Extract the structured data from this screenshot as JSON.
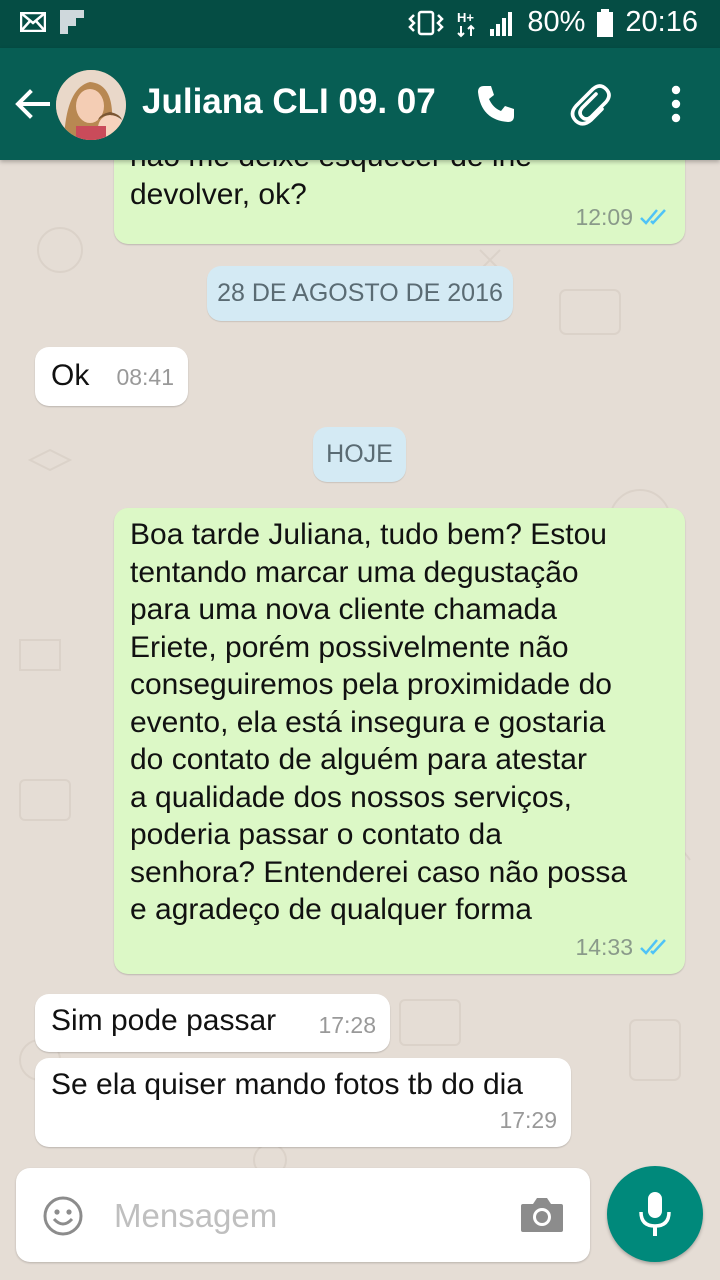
{
  "status_bar": {
    "battery": "80%",
    "time": "20:16",
    "icons": [
      "mail-icon",
      "flipboard-icon",
      "vibrate-icon",
      "hplus-icon",
      "signal-icon",
      "battery-icon"
    ]
  },
  "header": {
    "contact_name": "Juliana CLI 09. 07",
    "icons": [
      "back-arrow-icon",
      "phone-icon",
      "paperclip-icon",
      "more-vert-icon"
    ]
  },
  "messages": [
    {
      "direction": "outgoing",
      "text": "não me deixe esquecer de lhe\ndevolver, ok?",
      "time": "12:09",
      "status": "read"
    },
    {
      "type": "date",
      "label": "28 DE AGOSTO DE 2016"
    },
    {
      "direction": "incoming",
      "text": "Ok",
      "time": "08:41"
    },
    {
      "type": "date",
      "label": "HOJE"
    },
    {
      "direction": "outgoing",
      "text": "Boa tarde Juliana, tudo bem? Estou\ntentando marcar uma degustação\npara uma nova cliente chamada\nEriete, porém possivelmente não\nconseguiremos pela proximidade do\nevento, ela está insegura e gostaria\ndo contato de alguém para atestar\na qualidade dos nossos serviços,\npoderia passar o contato da\nsenhora? Entenderei caso não possa\ne agradeço de qualquer forma",
      "time": "14:33",
      "status": "read"
    },
    {
      "direction": "incoming",
      "text": "Sim pode passar",
      "time": "17:28"
    },
    {
      "direction": "incoming",
      "text": "Se ela quiser mando fotos tb do dia",
      "time": "17:29"
    }
  ],
  "composer": {
    "placeholder": "Mensagem",
    "icons": [
      "emoji-icon",
      "camera-icon",
      "mic-icon"
    ]
  },
  "colors": {
    "status_bar": "#054d44",
    "app_bar": "#075e54",
    "outgoing_bubble": "#dcf8c6",
    "incoming_bubble": "#ffffff",
    "date_chip": "#d4eaf4",
    "read_ticks": "#4fc3f7",
    "mic_button": "#00897b"
  }
}
